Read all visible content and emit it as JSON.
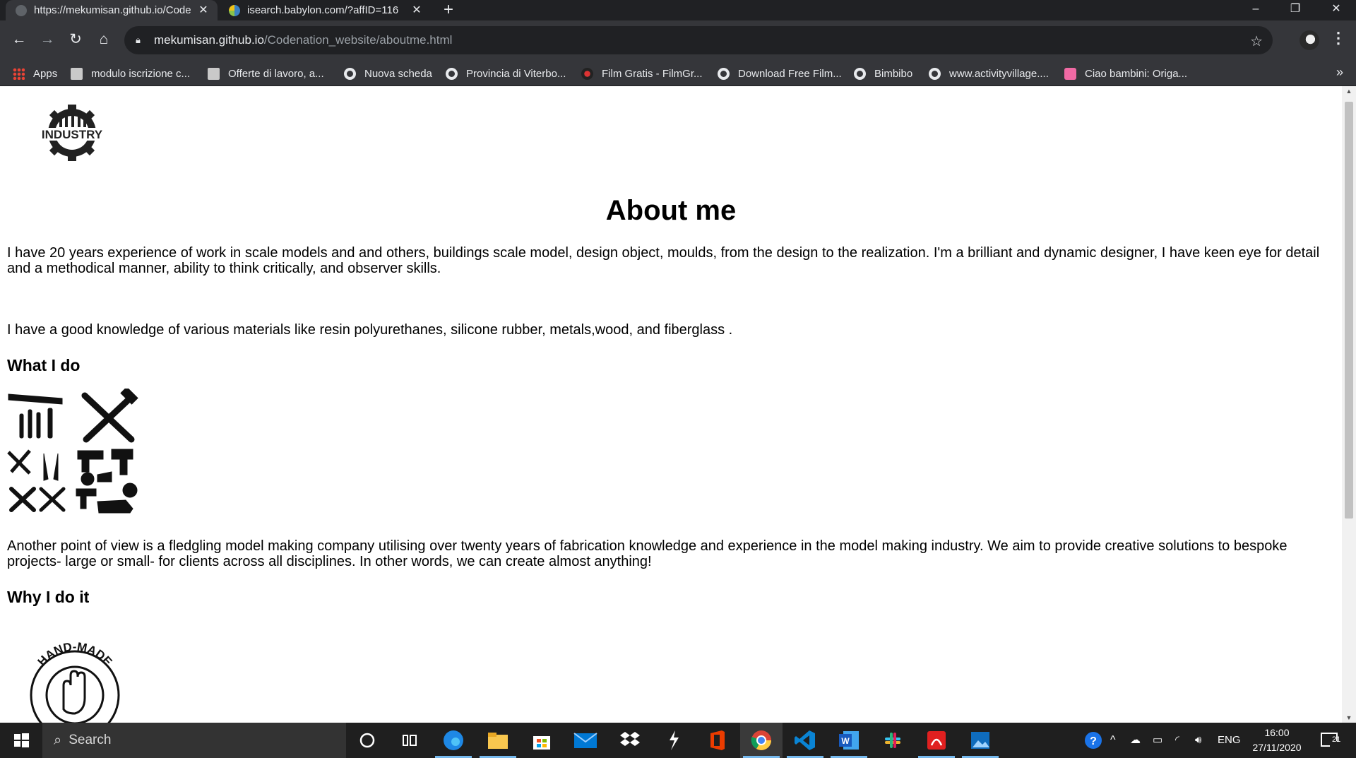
{
  "tabs": [
    {
      "title": "https://mekumisan.github.io/Codenation_website/aboutme.html",
      "active": true
    },
    {
      "title": "isearch.babylon.com/?affID=116",
      "active": false
    }
  ],
  "address": {
    "host": "mekumisan.github.io",
    "path": "/Codenation_website/aboutme.html"
  },
  "bookmarks": [
    {
      "label": "Apps",
      "icon": "apps-icon"
    },
    {
      "label": "modulo iscrizione c...",
      "icon": "document-icon"
    },
    {
      "label": "Offerte di lavoro, a...",
      "icon": "document-icon"
    },
    {
      "label": "Nuova scheda",
      "icon": "globe-icon"
    },
    {
      "label": "Provincia di Viterbo...",
      "icon": "globe-icon"
    },
    {
      "label": "Film Gratis - FilmGr...",
      "icon": "film-icon"
    },
    {
      "label": "Download Free Film...",
      "icon": "globe-icon"
    },
    {
      "label": "Bimbibo",
      "icon": "globe-icon"
    },
    {
      "label": "www.activityvillage....",
      "icon": "globe-icon"
    },
    {
      "label": "Ciao bambini: Origa...",
      "icon": "ciao-icon"
    }
  ],
  "page": {
    "logo_text": "INDUSTRY",
    "title": "About me",
    "intro": "I have 20 years experience of work in scale models and and others, buildings scale model, design object, moulds, from the design to the realization. I'm a brilliant and dynamic designer, I have keen eye for detail and a methodical manner, ability to think critically, and observer skills.",
    "materials": "I have a good knowledge of various materials like resin polyurethanes, silicone rubber, metals,wood, and fiberglass .",
    "what_heading": "What I do",
    "point_of_view": "Another point of view is a fledgling model making company utilising over twenty years of fabrication knowledge and experience in the model making industry. We aim to provide creative solutions to bespoke projects- large or small- for clients across all disciplines. In other words, we can create almost anything!",
    "why_heading": "Why I do it",
    "stamp_text": "HAND-MADE"
  },
  "taskbar": {
    "search_placeholder": "Search",
    "apps": [
      "cortana-icon",
      "task-view-icon",
      "edge-icon",
      "file-explorer-icon",
      "store-icon",
      "mail-icon",
      "dropbox-icon",
      "app-icon",
      "office-icon",
      "chrome-icon",
      "vscode-icon",
      "word-icon",
      "slack-icon",
      "acrobat-icon",
      "photos-icon"
    ],
    "language": "ENG",
    "time": "16:00",
    "date": "27/11/2020",
    "notification_count": "21"
  },
  "colors": {
    "chrome_dark": "#202124",
    "chrome_toolbar": "#35363a",
    "taskbar": "#1f1f1f",
    "accent": "#76b9ed"
  }
}
